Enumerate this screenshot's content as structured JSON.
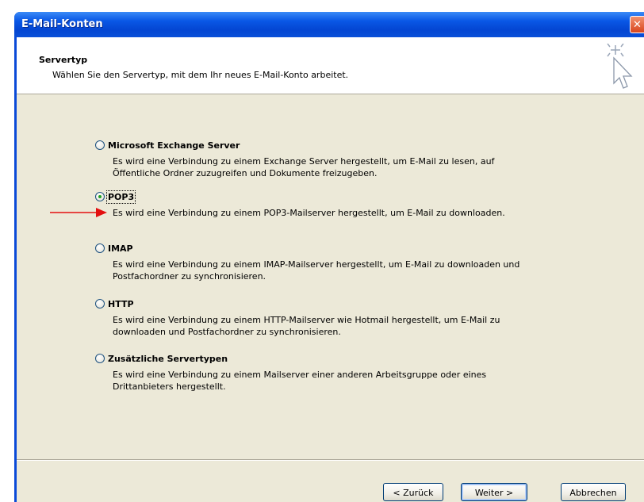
{
  "window": {
    "title": "E-Mail-Konten",
    "close_glyph": "✕"
  },
  "header": {
    "title": "Servertyp",
    "subtitle": "Wählen Sie den Servertyp, mit dem Ihr neues E-Mail-Konto arbeitet.",
    "icon": "wizard-sparkle-cursor-icon"
  },
  "options": [
    {
      "label": "Microsoft Exchange Server",
      "description": "Es wird eine Verbindung zu einem Exchange Server hergestellt, um E-Mail zu lesen, auf Öffentliche Ordner zuzugreifen und Dokumente freizugeben.",
      "selected": false
    },
    {
      "label": "POP3",
      "description": "Es wird eine Verbindung zu einem POP3-Mailserver hergestellt, um E-Mail zu downloaden.",
      "selected": true
    },
    {
      "label": "IMAP",
      "description": "Es wird eine Verbindung zu einem IMAP-Mailserver hergestellt, um E-Mail zu downloaden und Postfachordner zu synchronisieren.",
      "selected": false
    },
    {
      "label": "HTTP",
      "description": "Es wird eine Verbindung zu einem HTTP-Mailserver wie Hotmail hergestellt, um E-Mail zu downloaden und Postfachordner zu synchronisieren.",
      "selected": false
    },
    {
      "label": "Zusätzliche Servertypen",
      "description": "Es wird eine Verbindung zu einem Mailserver einer anderen Arbeitsgruppe oder eines Drittanbieters hergestellt.",
      "selected": false
    }
  ],
  "buttons": {
    "back": "< Zurück",
    "next": "Weiter >",
    "cancel": "Abbrechen"
  },
  "colors": {
    "titlebar": "#0a58e6",
    "dialog_bg": "#ece9d8",
    "annotation_arrow": "#e31010",
    "radio_dot": "#21a121"
  }
}
